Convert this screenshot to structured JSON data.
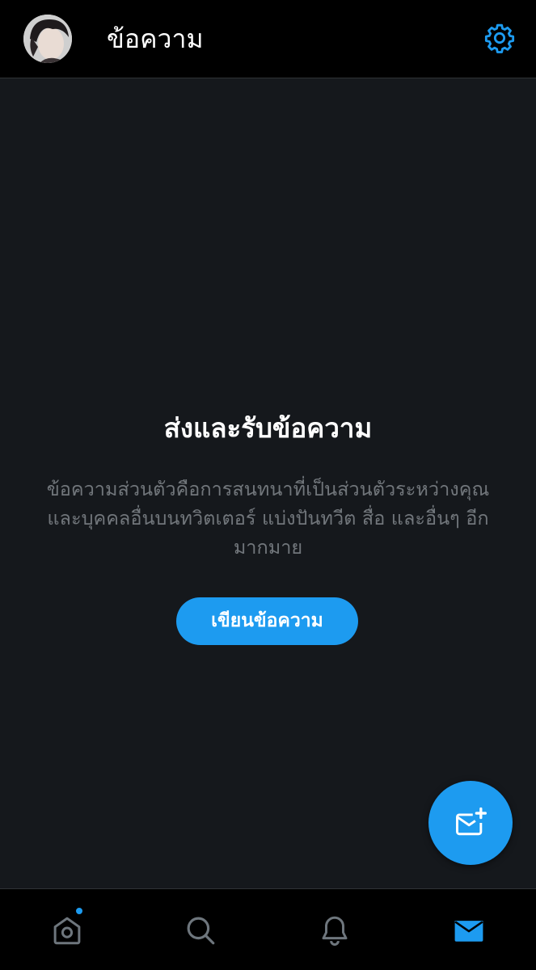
{
  "header": {
    "title": "ข้อความ",
    "avatar_icon": "user-avatar",
    "settings_icon": "gear-icon"
  },
  "empty_state": {
    "title": "ส่งและรับข้อความ",
    "description": "ข้อความส่วนตัวคือการสนทนาที่เป็นส่วนตัวระหว่างคุณและบุคคลอื่นบนทวิตเตอร์ แบ่งปันทวีต สื่อ และอื่นๆ อีกมากมาย",
    "button_label": "เขียนข้อความ"
  },
  "fab": {
    "icon": "new-message-icon"
  },
  "bottom_nav": {
    "items": [
      {
        "name": "home",
        "icon": "home-icon",
        "has_badge": true
      },
      {
        "name": "search",
        "icon": "search-icon"
      },
      {
        "name": "notifications",
        "icon": "bell-icon"
      },
      {
        "name": "messages",
        "icon": "envelope-icon",
        "active": true
      }
    ]
  },
  "colors": {
    "accent": "#1d9bf0",
    "background": "#15181c",
    "bar": "#000000",
    "secondary_text": "#71767b",
    "icon_inactive": "#6e767d"
  }
}
